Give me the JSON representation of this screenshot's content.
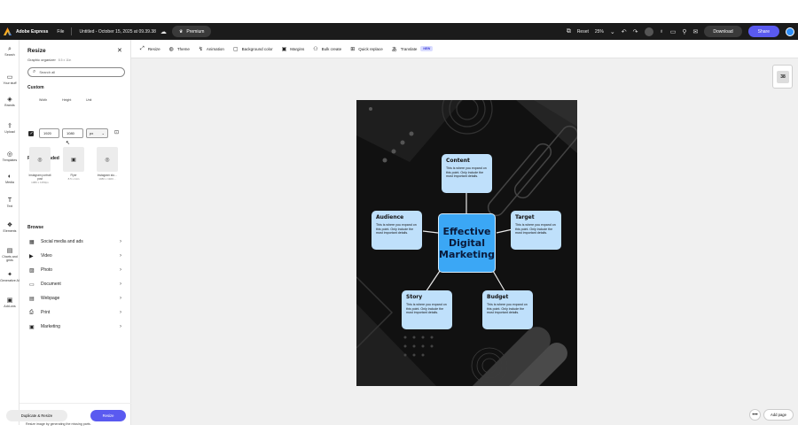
{
  "topbar": {
    "brand": "Adobe Express",
    "file_menu": "File",
    "doc_title": "Untitled - October 15, 2025 at 09.39.38",
    "premium": "Premium",
    "reset": "Reset",
    "zoom": "25%",
    "download": "Download",
    "share": "Share"
  },
  "rail": {
    "items": [
      {
        "label": "Search",
        "icon": "⌕"
      },
      {
        "label": "Your stuff",
        "icon": "▭"
      },
      {
        "label": "Brands",
        "icon": "◈"
      },
      {
        "label": "Upload",
        "icon": "⇪"
      },
      {
        "label": "Templates",
        "icon": "◎"
      },
      {
        "label": "Media",
        "icon": "◐"
      },
      {
        "label": "Text",
        "icon": "T"
      },
      {
        "label": "Elements",
        "icon": "❖"
      },
      {
        "label": "Charts and grids",
        "icon": "▤"
      },
      {
        "label": "Generative AI",
        "icon": "✦"
      },
      {
        "label": "Add-ons",
        "icon": "▣"
      }
    ]
  },
  "panel": {
    "title": "Resize",
    "subtitle": "Graphic organizer",
    "subtitle_size": "8.5 x 11in",
    "search_placeholder": "Search all",
    "custom": "Custom",
    "width_label": "Width",
    "height_label": "Height",
    "unit_label": "Unit",
    "width_value": "1920",
    "height_value": "1080",
    "unit_value": "px",
    "recommended": "Recommended",
    "rec_items": [
      {
        "name": "Instagram portrait post",
        "size": "1080 x 1350px",
        "icon": "◎"
      },
      {
        "name": "Flyer",
        "size": "8.5 x 11in",
        "icon": "▣"
      },
      {
        "name": "Instagram sto…",
        "size": "1080 x 1920…",
        "icon": "◎"
      }
    ],
    "browse": "Browse",
    "browse_items": [
      {
        "label": "Social media and ads",
        "icon": "▦"
      },
      {
        "label": "Video",
        "icon": "▶"
      },
      {
        "label": "Photo",
        "icon": "▨"
      },
      {
        "label": "Document",
        "icon": "▭"
      },
      {
        "label": "Webpage",
        "icon": "▤"
      },
      {
        "label": "Print",
        "icon": "⎙"
      },
      {
        "label": "Marketing",
        "icon": "▣"
      }
    ],
    "expand_label": "Expand image",
    "expand_desc": "Resize image by generating the missing parts.",
    "duplicate_resize": "Duplicate & Resize",
    "resize": "Resize"
  },
  "toolbar2": {
    "items": [
      {
        "label": "Resize",
        "icon": "⤢"
      },
      {
        "label": "Theme",
        "icon": "◍"
      },
      {
        "label": "Animation",
        "icon": "↯"
      },
      {
        "label": "Background color",
        "icon": "▢"
      },
      {
        "label": "Margins",
        "icon": "▣"
      },
      {
        "label": "Bulk create",
        "icon": "⚇"
      },
      {
        "label": "Quick replace",
        "icon": "⊞"
      },
      {
        "label": "Translate",
        "icon": "あ"
      }
    ],
    "new_badge": "NEW"
  },
  "canvas": {
    "center_title": "Effective Digital Marketing",
    "body_text": "This is where you expand on this point. Only include the most important details.",
    "nodes": [
      {
        "title": "Content"
      },
      {
        "title": "Audience"
      },
      {
        "title": "Target"
      },
      {
        "title": "Story"
      },
      {
        "title": "Budget"
      }
    ],
    "accent_color": "#3ba7f5",
    "node_color": "#bfe0fb"
  },
  "page_controls": {
    "page_number": "38",
    "add_page": "Add page"
  }
}
